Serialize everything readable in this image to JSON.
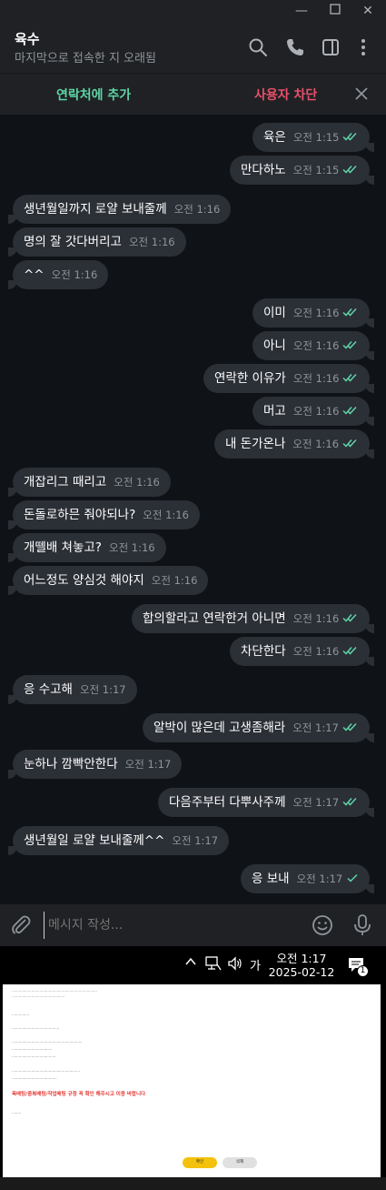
{
  "chat": {
    "contact_name": "육수",
    "contact_status": "마지막으로 접속한 지 오래됨",
    "add_contact": "연락처에 추가",
    "block_user": "사용자 차단",
    "input_placeholder": "메시지 작성...",
    "messages": [
      {
        "dir": "out",
        "text": "육은",
        "time": "오전 1:15",
        "check": "double"
      },
      {
        "dir": "out",
        "text": "만다하노",
        "time": "오전 1:15",
        "check": "double"
      },
      {
        "dir": "in",
        "text": "생년월일까지 로얄 보내줄께",
        "time": "오전 1:16"
      },
      {
        "dir": "in",
        "text": "명의 잘 갓다버리고",
        "time": "오전 1:16"
      },
      {
        "dir": "in",
        "text": "^^",
        "time": "오전 1:16"
      },
      {
        "dir": "out",
        "text": "이미",
        "time": "오전 1:16",
        "check": "double"
      },
      {
        "dir": "out",
        "text": "아니",
        "time": "오전 1:16",
        "check": "double"
      },
      {
        "dir": "out",
        "text": "연락한 이유가",
        "time": "오전 1:16",
        "check": "double"
      },
      {
        "dir": "out",
        "text": "머고",
        "time": "오전 1:16",
        "check": "double"
      },
      {
        "dir": "out",
        "text": "내 돈가온나",
        "time": "오전 1:16",
        "check": "double"
      },
      {
        "dir": "in",
        "text": "개잡리그 때리고",
        "time": "오전 1:16"
      },
      {
        "dir": "in",
        "text": "돈돌로하믄 줘야되나?",
        "time": "오전 1:16"
      },
      {
        "dir": "in",
        "text": "개뗄배 쳐놓고?",
        "time": "오전 1:16"
      },
      {
        "dir": "in",
        "text": "어느정도 양심것 해야지",
        "time": "오전 1:16"
      },
      {
        "dir": "out",
        "text": "합의할라고 연락한거 아니면",
        "time": "오전 1:16",
        "check": "double"
      },
      {
        "dir": "out",
        "text": "차단한다",
        "time": "오전 1:16",
        "check": "double"
      },
      {
        "dir": "in",
        "text": "응 수고해",
        "time": "오전 1:17"
      },
      {
        "dir": "out",
        "text": "알박이 많은데 고생좀해라",
        "time": "오전 1:17",
        "check": "double"
      },
      {
        "dir": "in",
        "text": "눈하나 깜빡안한다",
        "time": "오전 1:17"
      },
      {
        "dir": "out",
        "text": "다음주부터 다뿌사주께",
        "time": "오전 1:17",
        "check": "double"
      },
      {
        "dir": "in",
        "text": "생년월일 로얄 보내줄께^^",
        "time": "오전 1:17"
      },
      {
        "dir": "out",
        "text": "응 보내",
        "time": "오전 1:17",
        "check": "single"
      }
    ]
  },
  "taskbar": {
    "ime": "가",
    "time": "오전 1:17",
    "date": "2025-02-12",
    "notification_count": "1"
  },
  "colors": {
    "accent_green": "#5fd4a6",
    "danger_red": "#e8506a",
    "bubble": "#2b2f36",
    "chat_bg": "#0f1216",
    "header_bg": "#1f2124"
  },
  "popup": {
    "warning": "욕배팅/중복배팅/작업배팅 규정 꼭 확인 해주시고 이용 바랍니다",
    "confirm": "확인",
    "delete": "삭제"
  }
}
